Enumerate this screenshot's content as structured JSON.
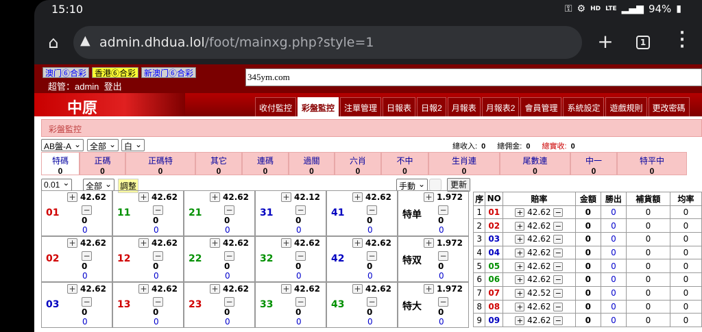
{
  "status": {
    "time": "15:10",
    "icons": [
      "key-icon",
      "settings-alert-icon",
      "hd-icon",
      "lte-icon",
      "signal-icon"
    ],
    "hd": "HD",
    "lte": "LTE",
    "battery": "94%"
  },
  "browser": {
    "url_host": "admin.dhdua.lol",
    "url_path": "/foot/mainxg.php?style=1",
    "tab_count": "1"
  },
  "header": {
    "lotteries": [
      {
        "label": "澳门⑥合彩",
        "active": false
      },
      {
        "label": "香港⑥合彩",
        "active": true
      },
      {
        "label": "新澳门⑥合彩",
        "active": false
      }
    ],
    "admin_text": "超管：admin",
    "logout": "登出",
    "ticker": "345ym.com",
    "logo": "中原",
    "menu": [
      {
        "label": "收付監控",
        "active": false
      },
      {
        "label": "彩盤監控",
        "active": true
      },
      {
        "label": "注單管理",
        "active": false
      },
      {
        "label": "日報表",
        "active": false
      },
      {
        "label": "日報2",
        "active": false
      },
      {
        "label": "月報表",
        "active": false
      },
      {
        "label": "月報表2",
        "active": false
      },
      {
        "label": "會員管理",
        "active": false
      },
      {
        "label": "系統設定",
        "active": false
      },
      {
        "label": "遊戲規則",
        "active": false
      },
      {
        "label": "更改密碼",
        "active": false
      }
    ]
  },
  "section_title": "彩盤監控",
  "filters": {
    "board": "AB盤-A",
    "scope": "全部",
    "color": "白",
    "total_income_label": "總收入:",
    "total_income": "0",
    "total_commission_label": "總佣金:",
    "total_commission": "0",
    "total_real_label": "總實收:",
    "total_real": "0"
  },
  "categories": [
    {
      "label": "特碼",
      "value": "0",
      "active": true
    },
    {
      "label": "正碼",
      "value": "0",
      "active": false
    },
    {
      "label": "正碼特",
      "value": "0",
      "active": false
    },
    {
      "label": "其它",
      "value": "0",
      "active": false
    },
    {
      "label": "連碼",
      "value": "0",
      "active": false
    },
    {
      "label": "過關",
      "value": "0",
      "active": false
    },
    {
      "label": "六肖",
      "value": "0",
      "active": false
    },
    {
      "label": "不中",
      "value": "0",
      "active": false
    },
    {
      "label": "生肖連",
      "value": "0",
      "active": false
    },
    {
      "label": "尾數連",
      "value": "0",
      "active": false
    },
    {
      "label": "中一",
      "value": "0",
      "active": false
    },
    {
      "label": "特平中",
      "value": "0",
      "active": false
    }
  ],
  "controls": {
    "step": "0.01",
    "scope": "全部",
    "adjust": "調整",
    "mode": "手動",
    "refresh": "更新"
  },
  "grid": [
    [
      {
        "num": "01",
        "color": "red",
        "odds": "42.62",
        "amount": "0",
        "win": "0"
      },
      {
        "num": "11",
        "color": "green",
        "odds": "42.62",
        "amount": "0",
        "win": "0"
      },
      {
        "num": "21",
        "color": "green",
        "odds": "42.62",
        "amount": "0",
        "win": "0"
      },
      {
        "num": "31",
        "color": "blue",
        "odds": "42.12",
        "amount": "0",
        "win": "0"
      },
      {
        "num": "41",
        "color": "blue",
        "odds": "42.62",
        "amount": "0",
        "win": "0"
      },
      {
        "num": "特单",
        "color": "black",
        "odds": "1.972",
        "amount": "0",
        "win": "0"
      }
    ],
    [
      {
        "num": "02",
        "color": "red",
        "odds": "42.62",
        "amount": "0",
        "win": "0"
      },
      {
        "num": "12",
        "color": "red",
        "odds": "42.62",
        "amount": "0",
        "win": "0"
      },
      {
        "num": "22",
        "color": "green",
        "odds": "42.62",
        "amount": "0",
        "win": "0"
      },
      {
        "num": "32",
        "color": "green",
        "odds": "42.62",
        "amount": "0",
        "win": "0"
      },
      {
        "num": "42",
        "color": "blue",
        "odds": "42.62",
        "amount": "0",
        "win": "0"
      },
      {
        "num": "特双",
        "color": "black",
        "odds": "1.972",
        "amount": "0",
        "win": "0"
      }
    ],
    [
      {
        "num": "03",
        "color": "blue",
        "odds": "42.62",
        "amount": "0",
        "win": "0"
      },
      {
        "num": "13",
        "color": "red",
        "odds": "42.62",
        "amount": "0",
        "win": "0"
      },
      {
        "num": "23",
        "color": "red",
        "odds": "42.62",
        "amount": "0",
        "win": "0"
      },
      {
        "num": "33",
        "color": "green",
        "odds": "42.62",
        "amount": "0",
        "win": "0"
      },
      {
        "num": "43",
        "color": "green",
        "odds": "42.62",
        "amount": "0",
        "win": "0"
      },
      {
        "num": "特大",
        "color": "black",
        "odds": "1.972",
        "amount": "0",
        "win": "0"
      }
    ]
  ],
  "table": {
    "headers": [
      "序",
      "NO",
      "賠率",
      "金額",
      "勝出",
      "補貨額",
      "均率"
    ],
    "rows": [
      {
        "seq": "1",
        "no": "01",
        "color": "red",
        "odds": "42.62",
        "amount": "0",
        "win": "0",
        "supp": "0",
        "avg": "0"
      },
      {
        "seq": "2",
        "no": "02",
        "color": "red",
        "odds": "42.62",
        "amount": "0",
        "win": "0",
        "supp": "0",
        "avg": "0"
      },
      {
        "seq": "3",
        "no": "03",
        "color": "blue",
        "odds": "42.62",
        "amount": "0",
        "win": "0",
        "supp": "0",
        "avg": "0"
      },
      {
        "seq": "4",
        "no": "04",
        "color": "blue",
        "odds": "42.62",
        "amount": "0",
        "win": "0",
        "supp": "0",
        "avg": "0"
      },
      {
        "seq": "5",
        "no": "05",
        "color": "green",
        "odds": "42.62",
        "amount": "0",
        "win": "0",
        "supp": "0",
        "avg": "0"
      },
      {
        "seq": "6",
        "no": "06",
        "color": "green",
        "odds": "42.62",
        "amount": "0",
        "win": "0",
        "supp": "0",
        "avg": "0"
      },
      {
        "seq": "7",
        "no": "07",
        "color": "red",
        "odds": "42.52",
        "amount": "0",
        "win": "0",
        "supp": "0",
        "avg": "0"
      },
      {
        "seq": "8",
        "no": "08",
        "color": "red",
        "odds": "42.62",
        "amount": "0",
        "win": "0",
        "supp": "0",
        "avg": "0"
      },
      {
        "seq": "9",
        "no": "09",
        "color": "blue",
        "odds": "42.62",
        "amount": "0",
        "win": "0",
        "supp": "0",
        "avg": "0"
      }
    ]
  },
  "colors": {
    "red": "#d00000",
    "green": "#009000",
    "blue": "#0000c0",
    "black": "#000000"
  }
}
